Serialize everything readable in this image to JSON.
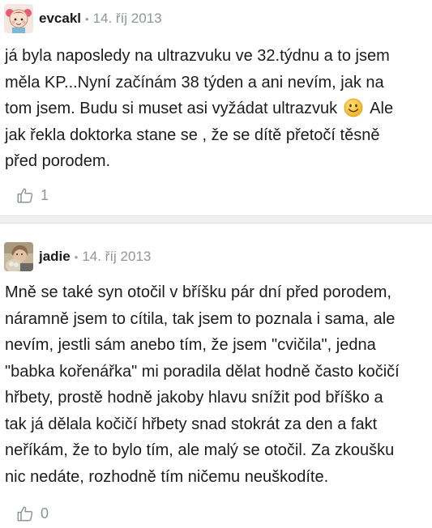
{
  "comments": [
    {
      "username": "evcakl",
      "separator": "•",
      "date": "14. říj 2013",
      "avatar_icon": "girl-cartoon-avatar",
      "text_lines": [
        "já byla naposledy na ultrazvuku ve 32.týdnu a to jsem",
        "měla KP...Nyní začínám 38 týden a ani nevím, jak na",
        "tom jsem. Budu si muset asi vyžádat ultrazvuk",
        "jak řekla doktorka stane se , že se dítě přetočí těsně",
        "před porodem."
      ],
      "text_after_emoji": "Ale",
      "emoji": "smiley-face",
      "like_icon": "thumbs-up-outline",
      "likes": "1"
    },
    {
      "username": "jadie",
      "separator": "•",
      "date": "14. říj 2013",
      "avatar_icon": "photo-avatar",
      "text_lines": [
        "Mně se také syn otočil v bříšku pár dní před porodem,",
        "náramně jsem to cítila, tak jsem to poznala i sama, ale",
        "nevím, jestli sám anebo tím, že jsem \"cvičila\", jedna",
        "\"babka kořenářka\" mi poradila dělat hodně často kočičí",
        "hřbety, prostě hodně jakoby hlavu snížit pod bříško a",
        "tak já dělala kočičí hřbety snad stokrát za den a fakt",
        "neříkám, že to bylo tím, ale malý se otočil. Za zkoušku",
        "nic nedáte, rozhodně tím ničemu neuškodíte."
      ],
      "like_icon": "thumbs-up-outline",
      "likes": "0"
    }
  ],
  "colors": {
    "separator_bg": "#eef0f1",
    "meta_gray": "#8f959a",
    "text": "#1c1c1c",
    "emoji_yellow": "#f7c531"
  }
}
